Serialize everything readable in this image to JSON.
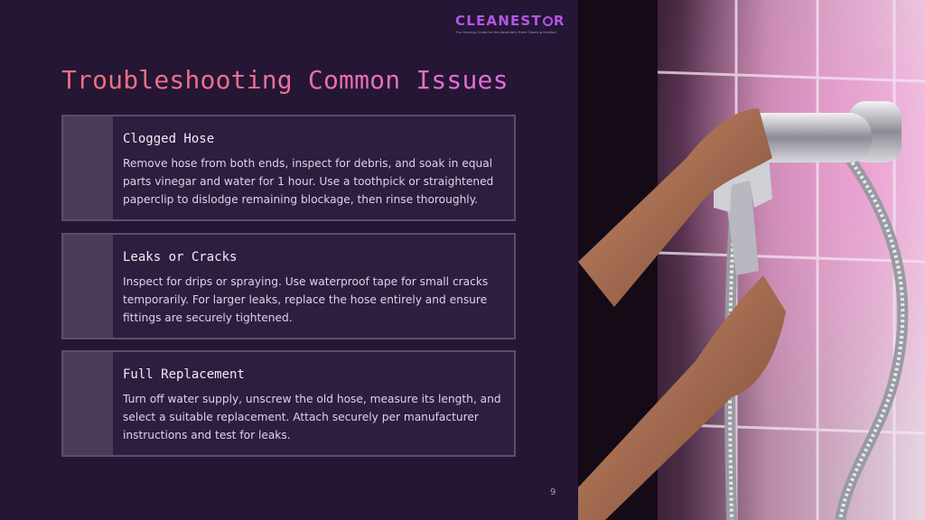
{
  "brand": {
    "name_prefix": "CLEANEST",
    "name_suffix": "R",
    "tagline": "The Cleaning Guide for the Absolutely Fresh Cleaning Solution",
    "color": "#b655e6"
  },
  "title": "Troubleshooting Common Issues",
  "cards": [
    {
      "title": "Clogged Hose",
      "body": "Remove hose from both ends, inspect for debris, and soak in equal parts vinegar and water for 1 hour. Use a toothpick or straightened paperclip to dislodge remaining blockage, then rinse thoroughly."
    },
    {
      "title": "Leaks or Cracks",
      "body": "Inspect for drips or spraying. Use waterproof tape for small cracks temporarily. For larger leaks, replace the hose entirely and ensure fittings are securely tightened."
    },
    {
      "title": "Full Replacement",
      "body": "Turn off water supply, unscrew the old hose, measure its length, and select a suitable replacement. Attach securely per manufacturer instructions and test for leaks."
    }
  ],
  "page_number": "9",
  "colors": {
    "background": "#241634",
    "card_border": "#5b4e6a",
    "card_accent": "#4b3c5c",
    "title_gradient_start": "#f06e7e",
    "title_gradient_end": "#e46be0"
  }
}
